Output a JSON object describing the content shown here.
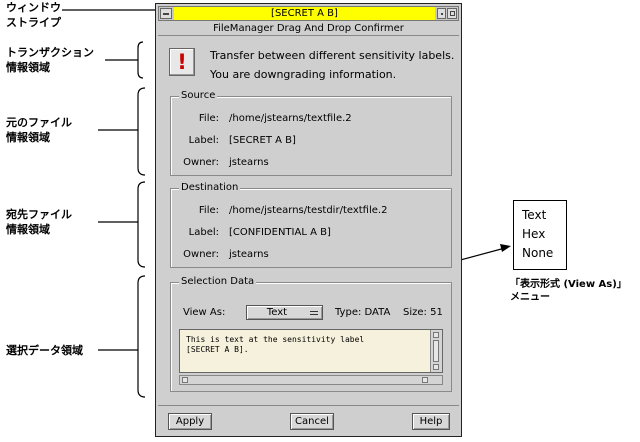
{
  "annotations": {
    "window_stripe": [
      "ウィンドウ",
      "ストライプ"
    ],
    "transaction_area": [
      "トランザクション",
      "情報領域"
    ],
    "source_area": [
      "元のファイル",
      "情報領域"
    ],
    "destination_area": [
      "宛先ファイル",
      "情報領域"
    ],
    "selection_area": "選択データ領域",
    "view_as_menu": [
      "「表示形式 (View As)」",
      "メニュー"
    ]
  },
  "window": {
    "stripe_label": "[SECRET A B]",
    "title": "FileManager Drag And Drop Confirmer"
  },
  "transaction": {
    "icon": "alert-icon",
    "line1": "Transfer between different sensitivity labels.",
    "line2": "You are downgrading information."
  },
  "source": {
    "title": "Source",
    "file_label": "File:",
    "file_value": "/home/jstearns/textfile.2",
    "label_label": "Label:",
    "label_value": "[SECRET A B]",
    "owner_label": "Owner:",
    "owner_value": "jstearns"
  },
  "destination": {
    "title": "Destination",
    "file_label": "File:",
    "file_value": "/home/jstearns/testdir/textfile.2",
    "label_label": "Label:",
    "label_value": "[CONFIDENTIAL A B]",
    "owner_label": "Owner:",
    "owner_value": "jstearns"
  },
  "selection": {
    "title": "Selection Data",
    "view_as_label": "View As:",
    "view_as_value": "Text",
    "type_text": "Type: DATA",
    "size_text": "Size: 51",
    "content_line1": "This is text at the sensitivity label",
    "content_line2": "[SECRET A B]."
  },
  "buttons": {
    "apply": "Apply",
    "cancel": "Cancel",
    "help": "Help"
  },
  "view_as_options": [
    "Text",
    "Hex",
    "None"
  ],
  "colors": {
    "stripe": "#ffff00",
    "alert": "#cc0000",
    "window_bg": "#cfcfcf",
    "textarea_bg": "#f6f1dc"
  }
}
